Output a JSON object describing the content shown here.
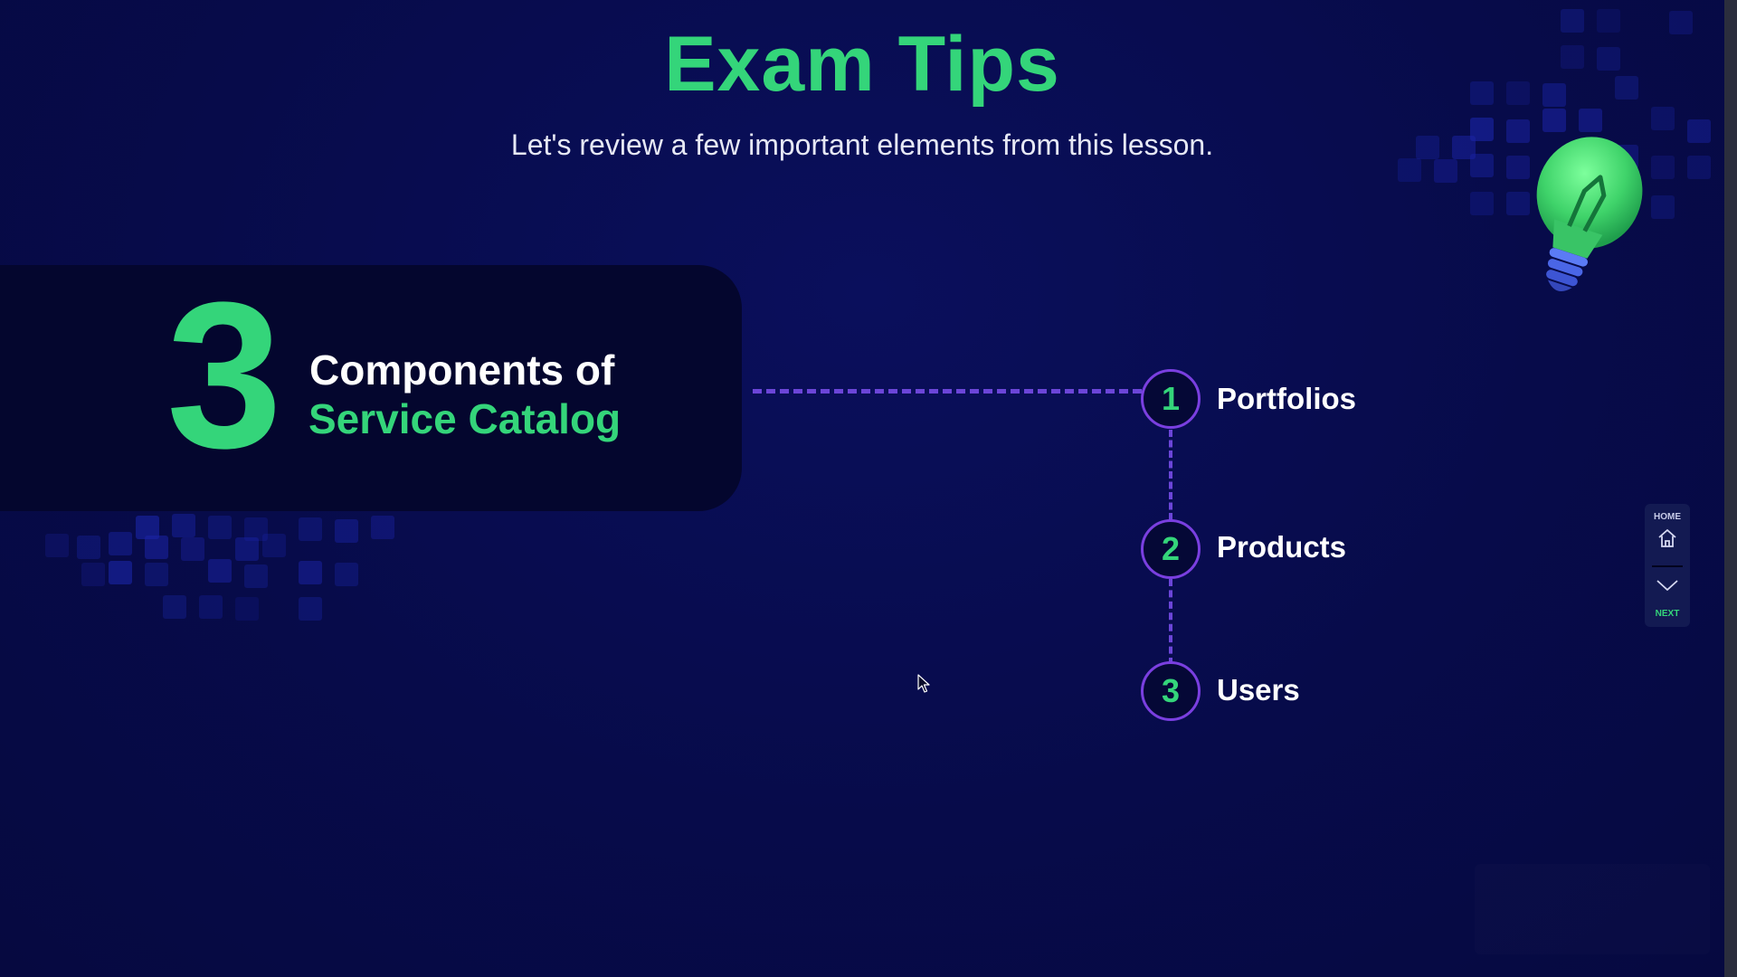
{
  "slide": {
    "title": "Exam Tips",
    "subtitle": "Let's review a few important elements from this lesson."
  },
  "panel": {
    "number": "3",
    "line1": "Components of",
    "line2": "Service Catalog"
  },
  "steps": [
    {
      "number": "1",
      "label": "Portfolios"
    },
    {
      "number": "2",
      "label": "Products"
    },
    {
      "number": "3",
      "label": "Users"
    }
  ],
  "nav": {
    "home_label": "HOME",
    "next_label": "NEXT",
    "home_icon": "home-icon",
    "next_icon": "chevron-down-icon"
  },
  "colors": {
    "background": "#070b4a",
    "accent_green": "#34d57a",
    "connector_purple": "#6b45d8",
    "panel_dark": "#04062e"
  }
}
